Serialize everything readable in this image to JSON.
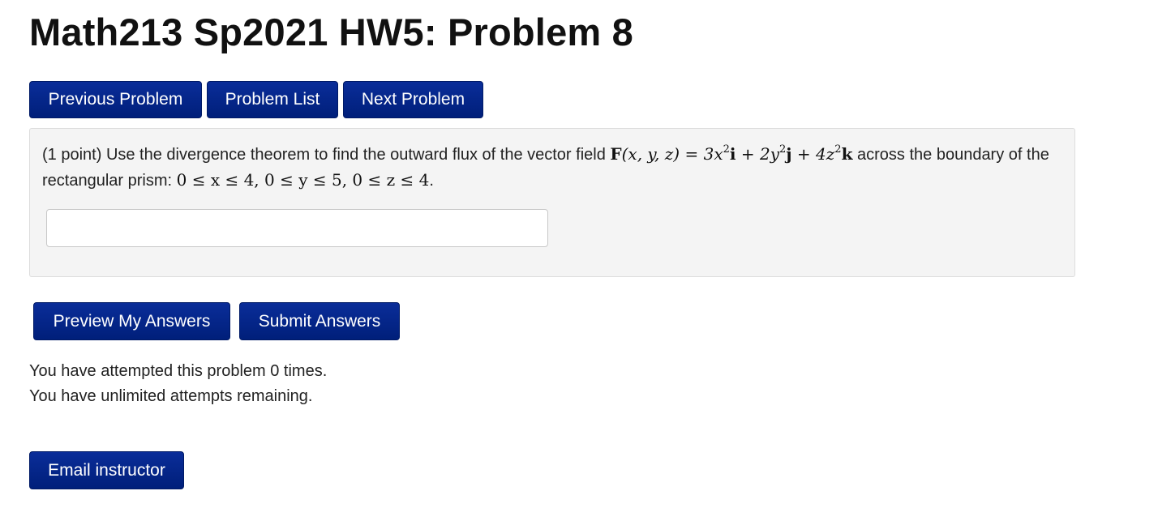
{
  "page": {
    "title": "Math213 Sp2021 HW5: Problem 8"
  },
  "nav": {
    "previous_label": "Previous Problem",
    "list_label": "Problem List",
    "next_label": "Next Problem"
  },
  "problem": {
    "points": "(1 point)",
    "text_before": "Use the divergence theorem to find the outward flux of the vector field",
    "text_middle": "across the boundary of the rectangular prism:",
    "text_after": ".",
    "field": {
      "name": "F",
      "args": "(x, y, z)",
      "i_coef": "3x",
      "j_coef": "2y",
      "k_coef": "4z",
      "exponent": "2"
    },
    "bounds": "0 ≤ x ≤ 4, 0 ≤ y ≤ 5, 0 ≤ z ≤ 4",
    "answer_value": "",
    "answer_placeholder": ""
  },
  "actions": {
    "preview_label": "Preview My Answers",
    "submit_label": "Submit Answers"
  },
  "status": {
    "attempts_line": "You have attempted this problem 0 times.",
    "remaining_line": "You have unlimited attempts remaining."
  },
  "footer": {
    "email_label": "Email instructor"
  },
  "colors": {
    "button_bg": "#032a8c",
    "panel_bg": "#f4f4f4"
  }
}
